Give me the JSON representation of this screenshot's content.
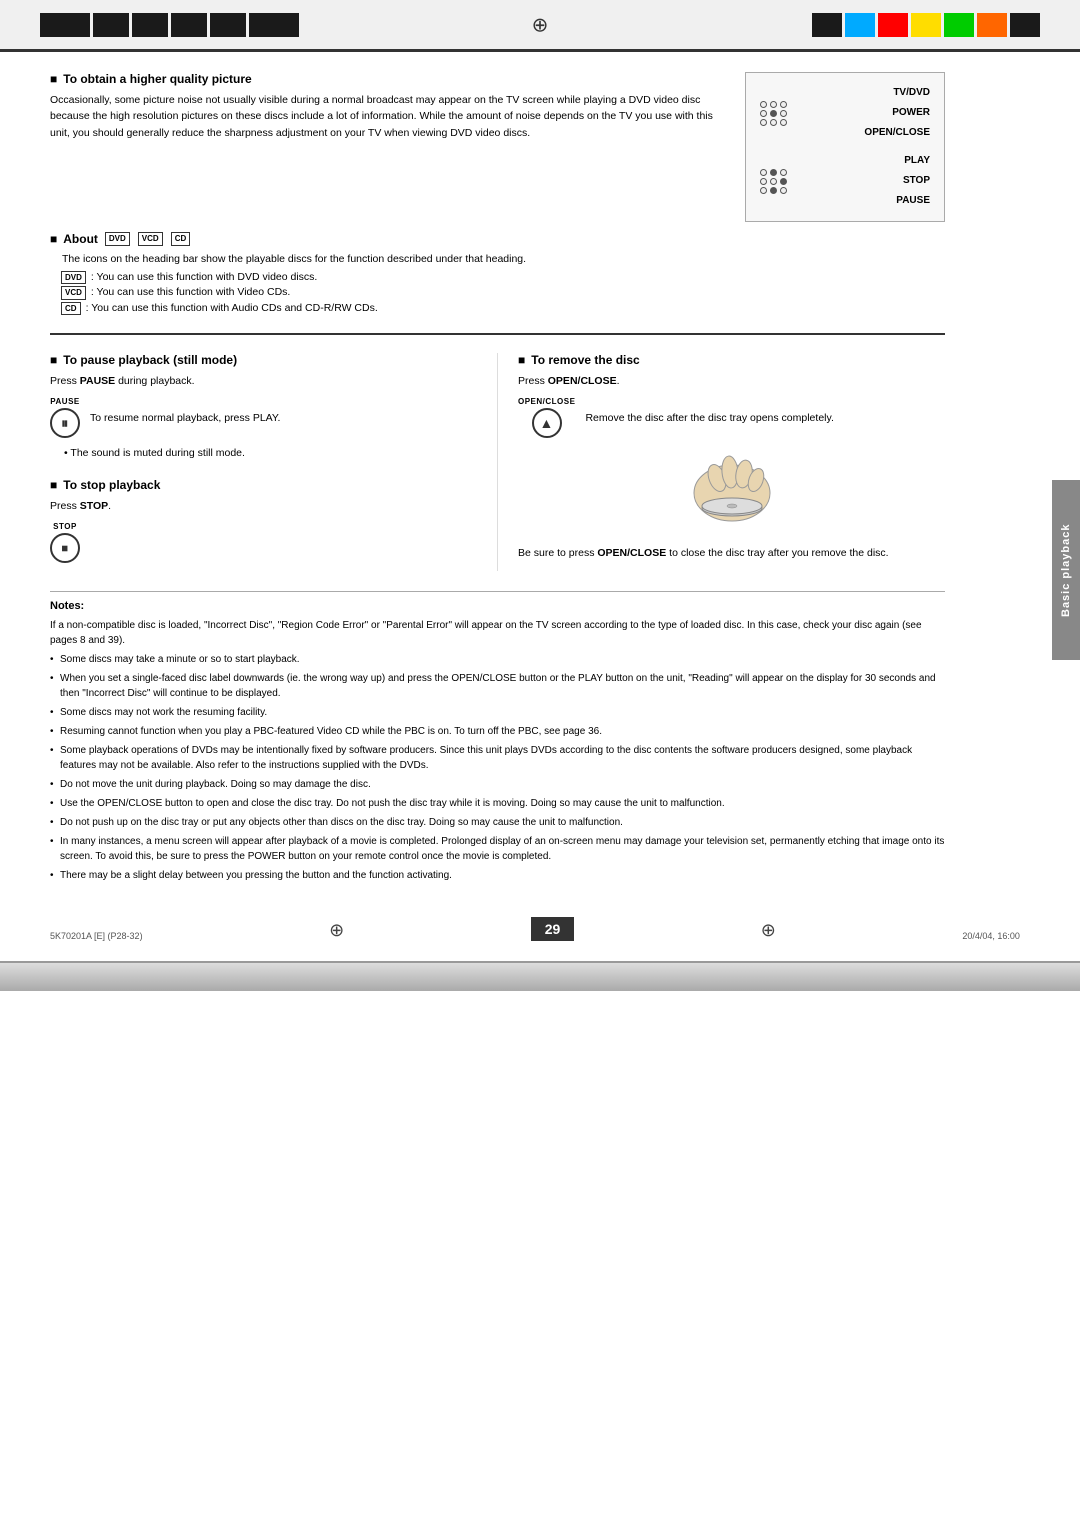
{
  "header": {
    "crosshair": "⊕",
    "colors": [
      "#1a1a1a",
      "#00aaff",
      "#ff0000",
      "#ffdd00",
      "#00cc00",
      "#ff6600",
      "#000000"
    ]
  },
  "page": {
    "number": "29",
    "side_tab": "Basic playback",
    "footer_left": "5K70201A [E] (P28-32)",
    "footer_center": "29",
    "footer_right": "20/4/04, 16:00"
  },
  "section_higher_quality": {
    "heading": "To obtain a higher quality picture",
    "body": "Occasionally, some picture noise not usually visible during a normal broadcast may appear on the TV screen while playing a DVD video disc because the high resolution pictures on these discs include a lot of information. While the amount of noise depends on the TV you use with this unit, you should generally reduce the sharpness adjustment on your TV when viewing DVD video discs."
  },
  "section_about": {
    "heading": "About",
    "disc_labels": [
      "DVD",
      "VCD",
      "CD"
    ],
    "intro": "The icons on the heading bar show the playable discs for the function described under that heading.",
    "items": [
      {
        "badge": "DVD",
        "text": ": You can use this function with DVD video discs."
      },
      {
        "badge": "VCD",
        "text": ": You can use this function with Video CDs."
      },
      {
        "badge": "CD",
        "text": ": You can use this function with Audio CDs and CD-R/RW CDs."
      }
    ]
  },
  "remote": {
    "labels": [
      "TV/DVD",
      "POWER",
      "OPEN/CLOSE",
      "PLAY",
      "STOP",
      "PAUSE"
    ]
  },
  "section_pause": {
    "heading": "To pause playback (still mode)",
    "press_text": "Press PAUSE during playback.",
    "pause_label": "PAUSE",
    "resume_text": "To resume normal playback, press PLAY.",
    "bullet": "The sound is muted during still mode."
  },
  "section_stop": {
    "heading": "To stop playback",
    "press_text": "Press STOP",
    "stop_label": "STOP"
  },
  "section_remove": {
    "heading": "To remove the disc",
    "press_text": "Press OPEN/CLOSE.",
    "open_label": "OPEN/CLOSE",
    "remove_text": "Remove the disc after the disc tray opens completely.",
    "note": "Be sure to press OPEN/CLOSE to close the disc tray after you remove the disc."
  },
  "notes": {
    "heading": "Notes:",
    "items": [
      "If a non-compatible disc is loaded, \"Incorrect Disc\", \"Region Code Error\" or \"Parental Error\" will appear on the TV screen according to the type of loaded disc. In this case, check your disc again (see pages 8 and 39).",
      "Some discs may take a minute or so to start playback.",
      "When you set a single-faced disc label downwards (ie. the wrong way up) and press the OPEN/CLOSE button or the PLAY button on the unit, \"Reading\" will appear on the display for 30 seconds and then \"Incorrect Disc\" will continue to be displayed.",
      "Some discs may not work the resuming facility.",
      "Resuming cannot function when you play a PBC-featured Video CD while the PBC is on. To turn off the PBC, see page 36.",
      "Some playback operations of DVDs may be intentionally fixed by software producers. Since this unit plays DVDs according to the disc contents the software producers designed, some playback features may not be available. Also refer to the instructions supplied with the DVDs.",
      "Do not move the unit during playback. Doing so may damage the disc.",
      "Use the OPEN/CLOSE button to open and close the disc tray. Do not push the disc tray while it is moving. Doing so may cause the unit to malfunction.",
      "Do not push up on the disc tray or put any objects other than discs on the disc tray. Doing so may cause the unit to malfunction.",
      "In many instances, a menu screen will appear after playback of a movie is completed. Prolonged display of an on-screen menu may damage your television set, permanently etching that image onto its screen. To avoid this, be sure to press the POWER button on your remote control once the movie is completed.",
      "There may be a slight delay between you pressing the button and the function activating."
    ]
  }
}
